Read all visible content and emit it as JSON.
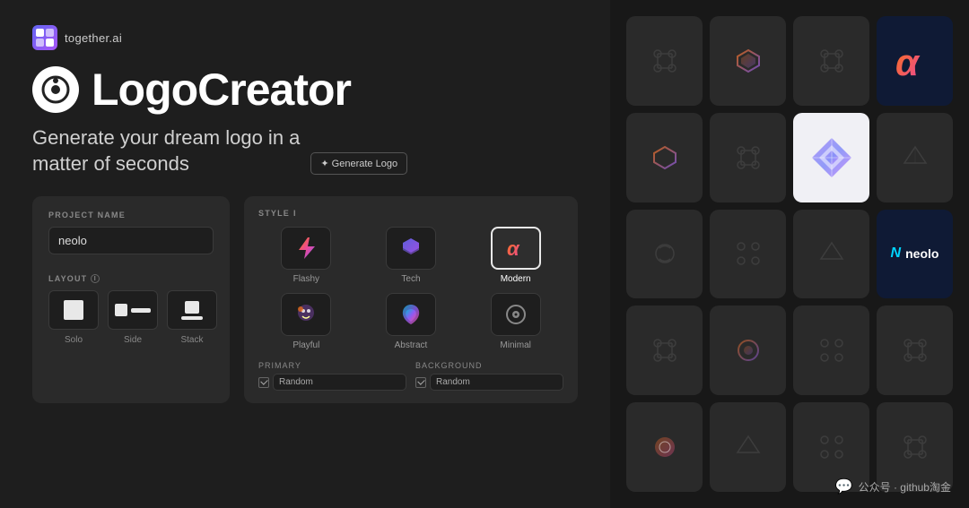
{
  "header": {
    "logo_text": "together.ai"
  },
  "title": {
    "brand": "LogoCreator"
  },
  "tagline": {
    "line1": "Generate your dream logo in a",
    "line2": "matter of seconds",
    "button_label": "✦ Generate Logo"
  },
  "form": {
    "project_name_label": "PROJECT NAME",
    "project_name_value": "neolo",
    "layout_label": "LAYOUT",
    "layout_info": "i",
    "layout_options": [
      {
        "id": "solo",
        "label": "Solo"
      },
      {
        "id": "side",
        "label": "Side"
      },
      {
        "id": "stack",
        "label": "Stack"
      }
    ]
  },
  "style": {
    "label": "STYLE",
    "options": [
      {
        "id": "flashy",
        "label": "Flashy",
        "selected": false
      },
      {
        "id": "tech",
        "label": "Tech",
        "selected": false
      },
      {
        "id": "modern",
        "label": "Modern",
        "selected": true
      },
      {
        "id": "playful",
        "label": "Playful",
        "selected": false
      },
      {
        "id": "abstract",
        "label": "Abstract",
        "selected": false
      },
      {
        "id": "minimal",
        "label": "Minimal",
        "selected": false
      }
    ],
    "primary_label": "PRIMARY",
    "primary_value": "Random",
    "background_label": "BACKGROUND",
    "background_value": "Random"
  },
  "watermark": {
    "text": "公众号 · github淘金"
  },
  "colors": {
    "accent_blue": "#00d4ff",
    "accent_orange": "#f97316",
    "accent_pink": "#ec4899",
    "accent_purple": "#8b5cf6"
  }
}
